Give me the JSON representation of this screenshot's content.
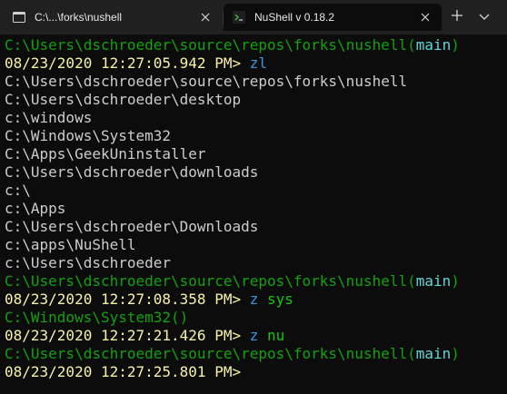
{
  "window": {
    "tabs": [
      {
        "title": "C:\\...\\forks\\nushell",
        "icon": "folder-terminal-icon",
        "active": false
      },
      {
        "title": "NuShell v 0.18.2",
        "icon": "terminal-prompt-icon",
        "active": true
      }
    ],
    "new_tab_label": "+",
    "colors": {
      "tabbar": "#202020",
      "background": "#0c0c0c",
      "path": "#13a10e",
      "branch": "#61d6d6",
      "timestamp": "#f9f1a5",
      "command": "#3a96dd",
      "arg": "#16c60c",
      "output": "#cccccc"
    }
  },
  "terminal": {
    "lines": [
      {
        "kind": "prompt-path",
        "path": "C:\\Users\\dschroeder\\source\\repos\\forks\\nushell(",
        "branch": "main",
        "close": ")"
      },
      {
        "kind": "prompt-cmd",
        "time": "08/23/2020 12:27:05.942 PM> ",
        "cmd": "zl",
        "arg": ""
      },
      {
        "kind": "output",
        "text": "C:\\Users\\dschroeder\\source\\repos\\forks\\nushell"
      },
      {
        "kind": "output",
        "text": "C:\\Users\\dschroeder\\desktop"
      },
      {
        "kind": "output",
        "text": "c:\\windows"
      },
      {
        "kind": "output",
        "text": "C:\\Windows\\System32"
      },
      {
        "kind": "output",
        "text": "C:\\Apps\\GeekUninstaller"
      },
      {
        "kind": "output",
        "text": "C:\\Users\\dschroeder\\downloads"
      },
      {
        "kind": "output",
        "text": "c:\\"
      },
      {
        "kind": "output",
        "text": "c:\\Apps"
      },
      {
        "kind": "output",
        "text": "C:\\Users\\dschroeder\\Downloads"
      },
      {
        "kind": "output",
        "text": "c:\\apps\\NuShell"
      },
      {
        "kind": "output",
        "text": "c:\\Users\\dschroeder"
      },
      {
        "kind": "prompt-path",
        "path": "C:\\Users\\dschroeder\\source\\repos\\forks\\nushell(",
        "branch": "main",
        "close": ")"
      },
      {
        "kind": "prompt-cmd",
        "time": "08/23/2020 12:27:08.358 PM> ",
        "cmd": "z",
        "arg": " sys"
      },
      {
        "kind": "prompt-path-plain",
        "path": "C:\\Windows\\System32",
        "close": "()"
      },
      {
        "kind": "prompt-cmd",
        "time": "08/23/2020 12:27:21.426 PM> ",
        "cmd": "z",
        "arg": " nu"
      },
      {
        "kind": "prompt-path",
        "path": "C:\\Users\\dschroeder\\source\\repos\\forks\\nushell(",
        "branch": "main",
        "close": ")"
      },
      {
        "kind": "prompt-cmd",
        "time": "08/23/2020 12:27:25.801 PM>",
        "cmd": "",
        "arg": ""
      }
    ]
  }
}
